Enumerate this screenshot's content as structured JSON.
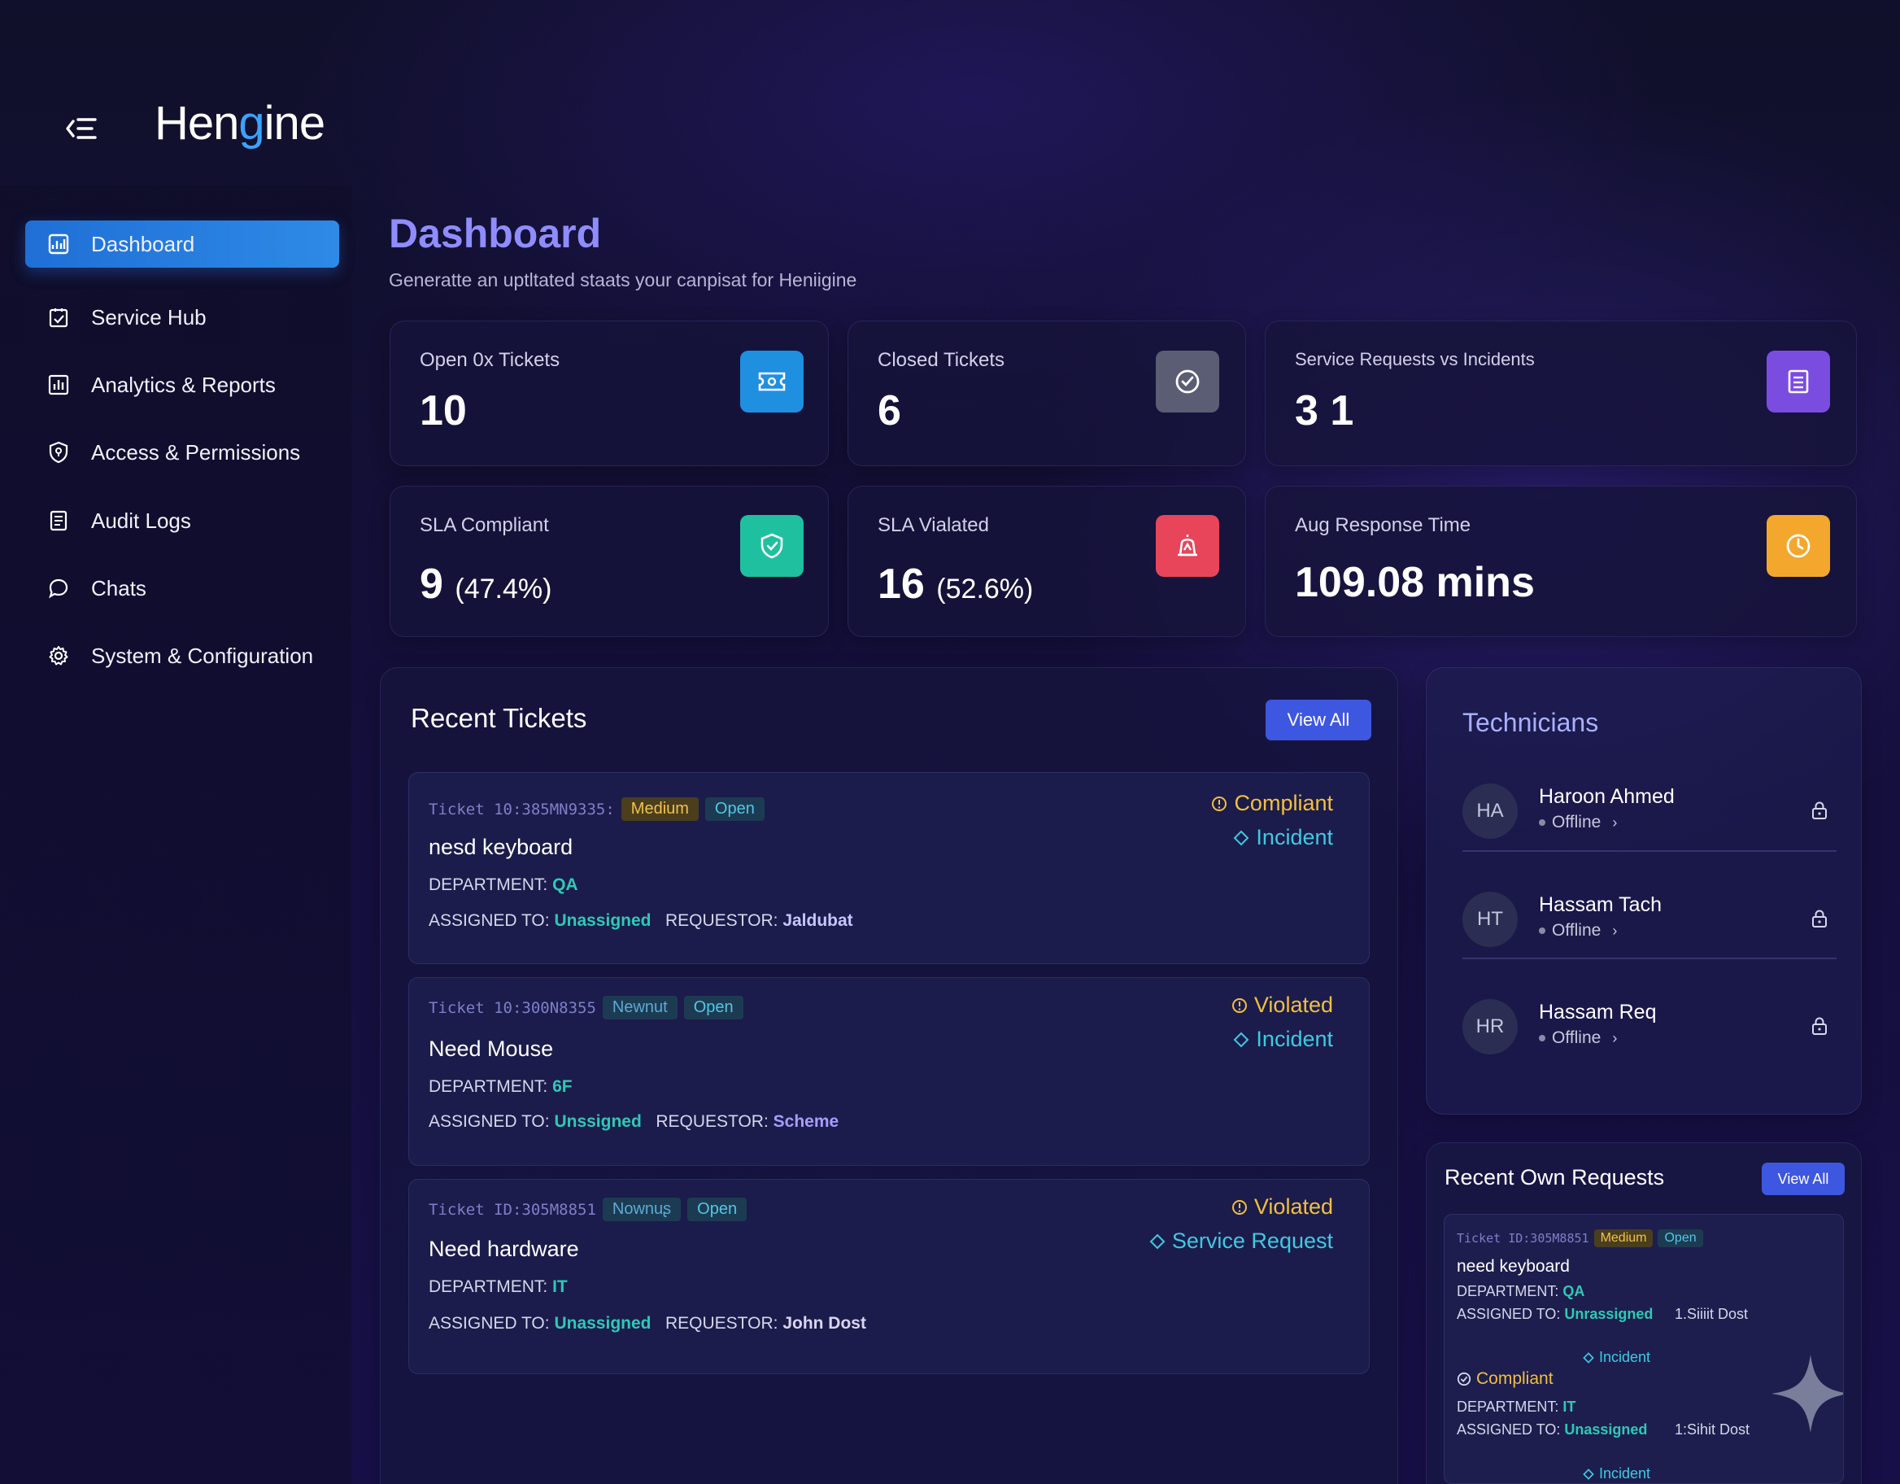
{
  "app": {
    "logo_prefix": "Hen",
    "logo_accent": "g",
    "logo_suffix": "ine"
  },
  "sidebar": {
    "items": [
      {
        "label": "Dashboard",
        "icon": "dashboard-icon",
        "active": true
      },
      {
        "label": "Service Hub",
        "icon": "clipboard-check-icon"
      },
      {
        "label": "Analytics & Reports",
        "icon": "bar-chart-icon"
      },
      {
        "label": "Access & Permissions",
        "icon": "shield-icon"
      },
      {
        "label": "Audit Logs",
        "icon": "document-icon"
      },
      {
        "label": "Chats",
        "icon": "chat-bubble-icon"
      },
      {
        "label": "System & Configuration",
        "icon": "gear-icon"
      }
    ]
  },
  "page": {
    "title": "Dashboard",
    "subtitle": "Generatte an uptltated staats your canpisat for Heniigine"
  },
  "stats": [
    {
      "label": "Open 0x Tickets",
      "value": "10",
      "pct": "",
      "icon": "ticket-icon",
      "color": "#1f8fe0"
    },
    {
      "label": "Closed Tickets",
      "value": "6",
      "pct": "",
      "icon": "check-circle-icon",
      "color": "#5b5d74"
    },
    {
      "label": "Service Requests vs Incidents",
      "value": "3 1",
      "pct": "",
      "icon": "document-icon",
      "color": "#7a4de0"
    },
    {
      "label": "SLA Compliant",
      "value": "9",
      "pct": "(47.4%)",
      "icon": "shield-check-icon",
      "color": "#1fc0a0"
    },
    {
      "label": "SLA Vialated",
      "value": "16",
      "pct": "(52.6%)",
      "icon": "alarm-icon",
      "color": "#e8455a"
    },
    {
      "label": "Aug Response Time",
      "value": "109.08 mins",
      "pct": "",
      "icon": "clock-icon",
      "color": "#f3a72d"
    }
  ],
  "recent_tickets": {
    "title": "Recent Tickets",
    "view_all": "View All",
    "tickets": [
      {
        "id": "Ticket 10:385MN9335:",
        "priority": "Medium",
        "state": "Open",
        "title": "nesd keyboard",
        "dept_label": "DEPARTMENT:",
        "dept": "QA",
        "assigned_label": "ASSIGNED TO:",
        "assigned": "Unassigned",
        "req_label": "REQUESTOR:",
        "requestor": "Jaldubat",
        "sla": "Compliant",
        "kind": "Incident"
      },
      {
        "id": "Ticket 10:300N8355",
        "priority": "Newnut",
        "state": "Open",
        "title": "Need Mouse",
        "dept_label": "DEPARTMENT:",
        "dept": "6F",
        "assigned_label": "ASSIGNED TO:",
        "assigned": "Unssigned",
        "req_label": "REQUESTOR:",
        "requestor": "Scheme",
        "sla": "Violated",
        "kind": "Incident"
      },
      {
        "id": "Ticket ID:305M8851",
        "priority": "Nownuʂ",
        "state": "Open",
        "title": "Need hardware",
        "dept_label": "DEPARTMENT:",
        "dept": "IT",
        "assigned_label": "ASSIGNED TO:",
        "assigned": "Unassigned",
        "req_label": "REQUESTOR:",
        "requestor": "John Dost",
        "sla": "Violated",
        "kind": "Service Request"
      }
    ]
  },
  "technicians": {
    "title": "Technicians",
    "list": [
      {
        "initials": "HA",
        "name": "Haroon Ahmed",
        "status": "Offline"
      },
      {
        "initials": "HT",
        "name": "Hassam Tach",
        "status": "Offline"
      },
      {
        "initials": "HR",
        "name": "Hassam Req",
        "status": "Offline"
      }
    ]
  },
  "own_requests": {
    "title": "Recent Own Requests",
    "view_all": "View All",
    "ticket": {
      "id": "Ticket ID:305M8851",
      "priority": "Medium",
      "state": "Open",
      "title": "need keyboard",
      "dept_label": "DEPARTMENT:",
      "dept": "QA",
      "assigned_label": "ASSIGNED TO:",
      "assigned": "Unrassigned",
      "requestor": "1.Siiiit Dost",
      "kind": "Incident",
      "sla": "Compliant",
      "dept2": "IT",
      "assigned2": "Unassigned",
      "requestor2": "1:Sihit Dost",
      "kind2": "Incident"
    }
  }
}
